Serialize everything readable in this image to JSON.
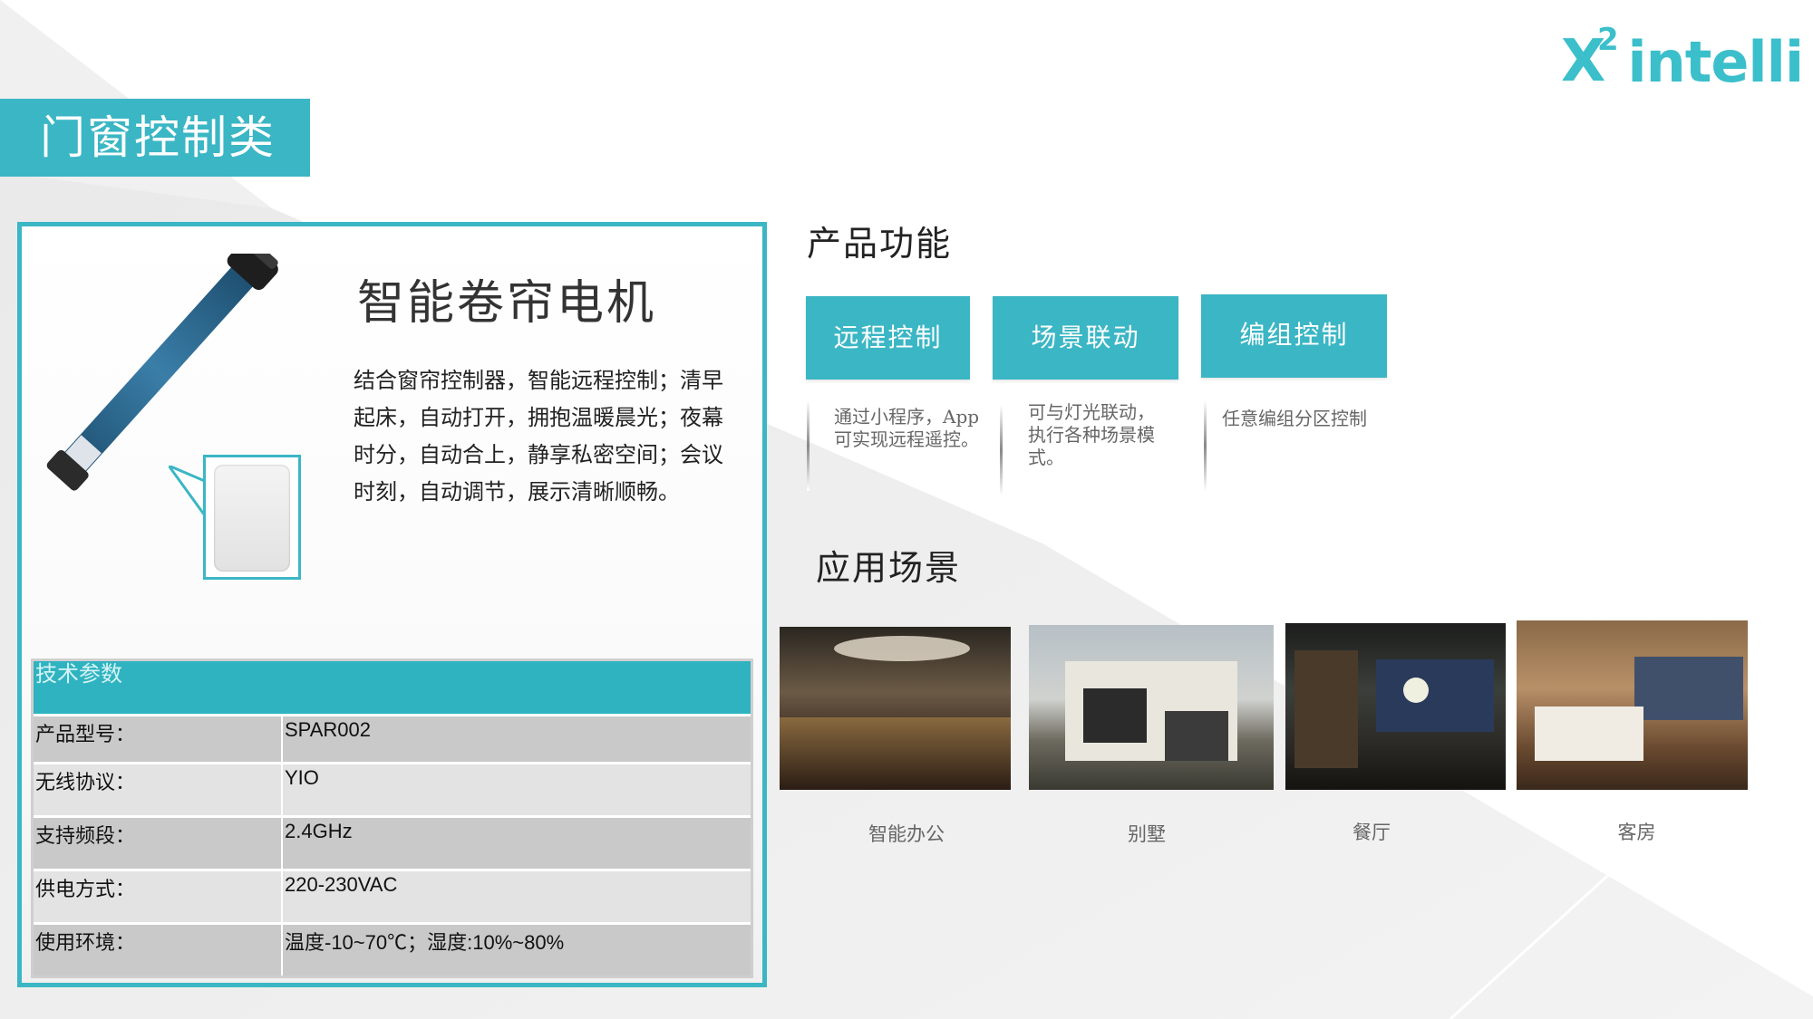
{
  "brand": {
    "logo_x": "X",
    "logo_sup": "2",
    "logo_word": "intelli",
    "accent": "#3bb6c4"
  },
  "category": "门窗控制类",
  "product": {
    "name": "智能卷帘电机",
    "description": "结合窗帘控制器，智能远程控制；清早起床，自动打开，拥抱温暖晨光；夜幕时分，自动合上，静享私密空间；会议时刻，自动调节，展示清晰顺畅。"
  },
  "specs": {
    "header": "技术参数",
    "rows": [
      {
        "key": "产品型号：",
        "value": "SPAR002"
      },
      {
        "key": "无线协议：",
        "value": "YIO"
      },
      {
        "key": "支持频段：",
        "value": "2.4GHz"
      },
      {
        "key": "供电方式：",
        "value": "220-230VAC"
      },
      {
        "key": "使用环境：",
        "value": "温度-10~70℃；湿度:10%~80%"
      }
    ]
  },
  "functions": {
    "title": "产品功能",
    "items": [
      {
        "label": "远程控制",
        "desc": "通过小程序，App\n可实现远程遥控。"
      },
      {
        "label": "场景联动",
        "desc": "可与灯光联动，\n执行各种场景模\n式。"
      },
      {
        "label": "编组控制",
        "desc": "任意编组分区控制"
      }
    ]
  },
  "scenes": {
    "title": "应用场景",
    "items": [
      {
        "label": "智能办公"
      },
      {
        "label": "别墅"
      },
      {
        "label": "餐厅"
      },
      {
        "label": "客房"
      }
    ]
  }
}
